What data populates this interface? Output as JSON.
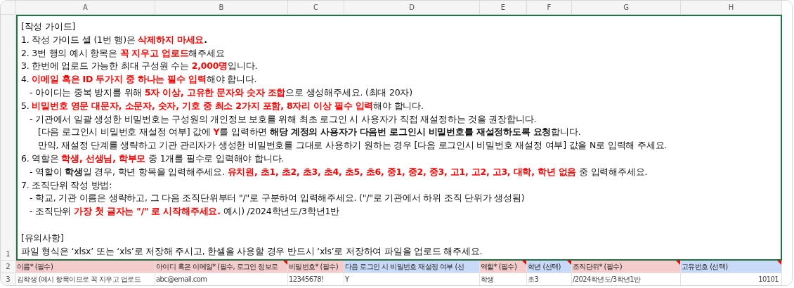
{
  "columns": [
    "A",
    "B",
    "C",
    "D",
    "E",
    "F",
    "G",
    "H"
  ],
  "guide_row": {
    "number": "1",
    "selected": true,
    "lines": [
      {
        "kind": "heading",
        "parts": [
          {
            "text": "[작성 가이드]",
            "kind": "normal"
          }
        ]
      },
      {
        "kind": "item",
        "parts": [
          {
            "text": "1. 작성 가이드 셀 (1번 행)은 ",
            "kind": "normal"
          },
          {
            "text": "삭제하지 마세요",
            "kind": "warning"
          },
          {
            "text": ".",
            "kind": "strong"
          }
        ]
      },
      {
        "kind": "item",
        "parts": [
          {
            "text": "2. 3번 행의 예시 항목은 ",
            "kind": "normal"
          },
          {
            "text": "꼭 지우고 업로드",
            "kind": "warning"
          },
          {
            "text": "해주세요",
            "kind": "normal"
          }
        ]
      },
      {
        "kind": "item",
        "parts": [
          {
            "text": "3. 한번에 업로드 가능한 최대 구성원 수는 ",
            "kind": "normal"
          },
          {
            "text": "2,000명",
            "kind": "warning"
          },
          {
            "text": "입니다.",
            "kind": "normal"
          }
        ]
      },
      {
        "kind": "item",
        "parts": [
          {
            "text": "4. ",
            "kind": "normal"
          },
          {
            "text": "이메일 혹은 ID 두가지 중 하나는 필수 입력",
            "kind": "warning"
          },
          {
            "text": "해야 합니다.",
            "kind": "normal"
          }
        ]
      },
      {
        "kind": "sub",
        "parts": [
          {
            "text": "- 아이디는 중복 방지를 위해 ",
            "kind": "normal"
          },
          {
            "text": "5자 이상, 고유한 문자와 숫자 조합",
            "kind": "warning"
          },
          {
            "text": "으로 생성해주세요. (최대 20자)",
            "kind": "normal"
          }
        ]
      },
      {
        "kind": "item",
        "parts": [
          {
            "text": "5. ",
            "kind": "normal"
          },
          {
            "text": "비밀번호 영문 대문자, 소문자, 숫자, 기호 중 최소 2가지 포함, 8자리 이상 필수 입력",
            "kind": "warning"
          },
          {
            "text": "해야 합니다.",
            "kind": "normal"
          }
        ]
      },
      {
        "kind": "sub",
        "parts": [
          {
            "text": "- 기관에서 일괄 생성한 비밀번호는 구성원의 개인정보 보호를 위해 최초 로그인 시 사용자가 직접 재설정하는 것을 권장합니다.",
            "kind": "normal"
          }
        ]
      },
      {
        "kind": "cont",
        "parts": [
          {
            "text": "[다음 로그인시 비밀번호 재설정 여부] 값에 ",
            "kind": "normal"
          },
          {
            "text": "Y",
            "kind": "warning"
          },
          {
            "text": "를 입력하면 ",
            "kind": "normal"
          },
          {
            "text": "해당 계정의 사용자가 다음번 로그인시 비밀번호를 재설정하도록 요청",
            "kind": "strong"
          },
          {
            "text": "합니다.",
            "kind": "normal"
          }
        ]
      },
      {
        "kind": "cont",
        "parts": [
          {
            "text": "만약, 재설정 단계를 생략하고 기관 관리자가 생성한 비밀번호를 그대로 사용하기 원하는 경우 [다음 로그인시 비밀번호 재설정 여부] 값을 N로 입력해 주세요.",
            "kind": "normal"
          }
        ]
      },
      {
        "kind": "item",
        "parts": [
          {
            "text": "6. 역할은 ",
            "kind": "normal"
          },
          {
            "text": "학생, 선생님, 학부모",
            "kind": "warning"
          },
          {
            "text": " 중 1개를 필수로 입력해야 합니다.",
            "kind": "normal"
          }
        ]
      },
      {
        "kind": "sub",
        "parts": [
          {
            "text": "- 역할이 ",
            "kind": "normal"
          },
          {
            "text": "학생",
            "kind": "strong"
          },
          {
            "text": "일 경우, 학년 항목을 입력해주세요. ",
            "kind": "normal"
          },
          {
            "text": "유치원, 초1, 초2, 초3, 초4, 초5, 초6, 중1, 중2, 중3, 고1, 고2, 고3, 대학, 학년 없음",
            "kind": "warning"
          },
          {
            "text": " 중 입력해주세요.",
            "kind": "normal"
          }
        ]
      },
      {
        "kind": "item",
        "parts": [
          {
            "text": "7. 조직단위 작성 방법:",
            "kind": "normal"
          }
        ]
      },
      {
        "kind": "sub",
        "parts": [
          {
            "text": "- 학교, 기관 이름은 생략하고, 그 다음 조직단위부터 \"/\"로 구분하여 입력해주세요. (\"/\"로 기관에서 하위 조직 단위가 생성됨)",
            "kind": "normal"
          }
        ]
      },
      {
        "kind": "sub",
        "parts": [
          {
            "text": "- 조직단위 ",
            "kind": "normal"
          },
          {
            "text": "가장 첫 글자는 \"/\" 로 시작해주세요.",
            "kind": "warning"
          },
          {
            "text": " 예시) /2024학년도/3학년1반",
            "kind": "normal"
          }
        ]
      },
      {
        "kind": "section",
        "parts": [
          {
            "text": "[유의사항]",
            "kind": "normal"
          }
        ]
      },
      {
        "kind": "item",
        "parts": [
          {
            "text": "파일 형식은 ‘xlsx’ 또는 ‘xls’로 저장해 주시고, 한셀을 사용할 경우 반드시 ‘xls’로 저장하여 파일을 업로드 해주세요.",
            "kind": "normal"
          }
        ]
      }
    ]
  },
  "header_row": {
    "number": "2",
    "cells": [
      {
        "text": "이름* (필수)",
        "color": "#f4cccc",
        "comment": false
      },
      {
        "text": "아이디 혹은 이메일* (필수, 로그인 정보로",
        "color": "#f4cccc",
        "comment": true
      },
      {
        "text": "비밀번호* (필수)",
        "color": "#f4cccc",
        "comment": false
      },
      {
        "text": "다음 로그인 시 비밀번호 재설정 여부 (선",
        "color": "#c9daf8",
        "comment": false
      },
      {
        "text": "역할* (필수)",
        "color": "#f4cccc",
        "comment": true
      },
      {
        "text": "학년 (선택)",
        "color": "#c9daf8",
        "comment": true
      },
      {
        "text": "조직단위* (필수)",
        "color": "#f4cccc",
        "comment": true
      },
      {
        "text": "고유번호 (선택)",
        "color": "#c9daf8",
        "comment": true
      }
    ]
  },
  "example_row": {
    "number": "3",
    "cells": [
      {
        "text": "김학생 (예시 항목이므로 꼭 지우고 업로드",
        "kind": "text"
      },
      {
        "text": "abc@email.com",
        "kind": "text"
      },
      {
        "text": "12345678!",
        "kind": "text"
      },
      {
        "text": "Y",
        "kind": "text"
      },
      {
        "text": "학생",
        "kind": "text"
      },
      {
        "text": "초3",
        "kind": "text"
      },
      {
        "text": "/2024학년도/3학년1반",
        "kind": "text"
      },
      {
        "text": "10101",
        "kind": "number"
      }
    ]
  }
}
